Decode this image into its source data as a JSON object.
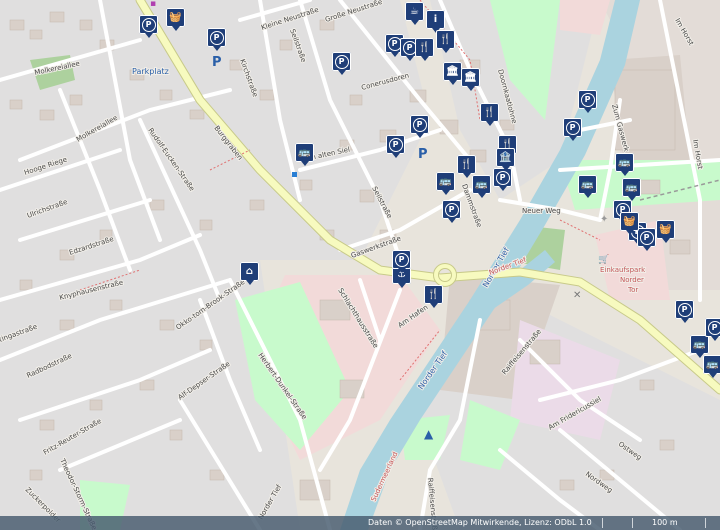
{
  "map": {
    "street_labels": {
      "molkereiallee": "Molkereiallee",
      "molkereiallee_2": "Molkereiallee",
      "hooge_riege": "Hooge Riege",
      "ulrichstrasse": "Ulrichstraße",
      "edzardstrasse": "Edzardstraße",
      "knyphausenstrasse": "Knyphausenstraße",
      "rudolf_eucken_strasse": "Rudolf-Eucken-Straße",
      "burggraben": "Burggraben",
      "kirchstrasse": "Kirchstraße",
      "kleine_neustrasse": "Kleine Neustraße",
      "grosse_neustrasse": "Große Neustraße",
      "seilstrasse": "Seilstraße",
      "seilstrasse_2": "Seilstraße",
      "conerusdoren": "Conerusdoren",
      "in_alten_siel": "in alten Siel",
      "gaswerkstrasse": "Gaswerkstraße",
      "dammstrasse": "Dammstraße",
      "doornkaatlohne": "Doornkaatlohne",
      "neuer_weg": "Neuer Weg",
      "zum_gaswerk": "Zum Gaswerk",
      "im_horst": "Im Horst",
      "im_horst_2": "Im Horst",
      "okko_tom_brook_strasse": "Okko-tom-Brook-Straße",
      "alf_depser_strasse": "Alf-Depser-Straße",
      "herbert_dunkel_strasse": "Herbert-Dunkel-Straße",
      "schlachthausstrasse": "Schlachthausstraße",
      "am_hafen": "Am Hafen",
      "norder_tief": "Norder Tief",
      "norder_tief_2": "Norder Tief",
      "norder_tief_3": "Norder Tief",
      "raiffeisenstrasse": "Raiffeisenstraße",
      "raiffeisenstrasse_2": "Raiffeisenstraße",
      "am_fridericussiel": "Am Fridericussiel",
      "ostweg": "Ostweg",
      "nordweg": "Nordweg",
      "radbodstrasse": "Radbodstraße",
      "tiergstrasse": "tingastraße",
      "fritz_reuter_strasse": "Fritz-Reuter-Straße",
      "theodor_storm_strasse": "Theodor-Storm-Straße",
      "zuckerpolder": "Zuckerpolder",
      "norder_tief_city": "Norder Tief",
      "sudermeerland": "Sudermeerland",
      "norder_tief_center": "Norder Tief"
    },
    "place_labels": {
      "parkplatz": "Parkplatz",
      "einkaufspark_line1": "Einkaufspark",
      "einkaufspark_line2": "Norder",
      "einkaufspark_line3": "Tor"
    },
    "colors": {
      "background": "#e8e4dc",
      "residential": "#e0dfdf",
      "building": "#d9d0c9",
      "road": "#ffffff",
      "primary_road": "#f7fabf",
      "primary_road_casing": "#c8ca8a",
      "water": "#aad3df",
      "park": "#c8facc",
      "green": "#add19e",
      "retail": "#ffd6d1",
      "commercial": "#f2dad9",
      "industrial": "#ebdbe8",
      "marker": "#1f3e78",
      "parking_text": "#2a5fa8"
    },
    "markers": [
      {
        "icon": "parking-icon",
        "glyph": "P"
      },
      {
        "icon": "shopping-basket-icon",
        "glyph": "🧺"
      },
      {
        "icon": "parking-icon",
        "glyph": "P"
      },
      {
        "icon": "parking-icon",
        "glyph": "P"
      },
      {
        "icon": "parking-icon",
        "glyph": "P"
      },
      {
        "icon": "cafe-icon",
        "glyph": "☕"
      },
      {
        "icon": "info-icon",
        "glyph": "i"
      },
      {
        "icon": "parking-icon",
        "glyph": "P"
      },
      {
        "icon": "restaurant-icon",
        "glyph": "🍴"
      },
      {
        "icon": "restaurant-icon",
        "glyph": "🍴"
      },
      {
        "icon": "museum-icon",
        "glyph": "🏛"
      },
      {
        "icon": "museum-icon",
        "glyph": "🏛"
      },
      {
        "icon": "parking-icon",
        "glyph": "P"
      },
      {
        "icon": "parking-icon",
        "glyph": "P"
      },
      {
        "icon": "restaurant-icon",
        "glyph": "🍴"
      },
      {
        "icon": "parking-icon",
        "glyph": "P"
      },
      {
        "icon": "bus-icon",
        "glyph": "🚌"
      },
      {
        "icon": "restaurant-icon",
        "glyph": "🍴"
      },
      {
        "icon": "bus-icon",
        "glyph": "🚌"
      },
      {
        "icon": "bus-icon",
        "glyph": "🚌"
      },
      {
        "icon": "parking-icon",
        "glyph": "P"
      },
      {
        "icon": "parking-icon",
        "glyph": "P"
      },
      {
        "icon": "bus-icon",
        "glyph": "🚌"
      },
      {
        "icon": "bus-icon",
        "glyph": "🚌"
      },
      {
        "icon": "restaurant-icon",
        "glyph": "🍴"
      },
      {
        "icon": "parking-icon",
        "glyph": "P"
      },
      {
        "icon": "bus-icon",
        "glyph": "🚌"
      },
      {
        "icon": "parking-icon",
        "glyph": "P"
      },
      {
        "icon": "parking-icon",
        "glyph": "P"
      },
      {
        "icon": "shopping-basket-icon",
        "glyph": "🧺"
      },
      {
        "icon": "parking-icon",
        "glyph": "P"
      },
      {
        "icon": "shopping-basket-icon",
        "glyph": "🧺"
      },
      {
        "icon": "parking-icon",
        "glyph": "P"
      },
      {
        "icon": "bus-icon",
        "glyph": "🚌"
      },
      {
        "icon": "parking-icon",
        "glyph": "P"
      },
      {
        "icon": "home-icon",
        "glyph": "⌂"
      },
      {
        "icon": "ferry-icon",
        "glyph": "⚓"
      },
      {
        "icon": "parking-icon",
        "glyph": "P"
      },
      {
        "icon": "bank-icon",
        "glyph": "🏦"
      },
      {
        "icon": "restaurant-icon",
        "glyph": "🍴"
      },
      {
        "icon": "bus-icon",
        "glyph": "🚌"
      }
    ]
  },
  "attribution": {
    "text": "Daten © OpenStreetMap Mitwirkende, Lizenz: ODbL 1.0",
    "scale": "100 m"
  }
}
